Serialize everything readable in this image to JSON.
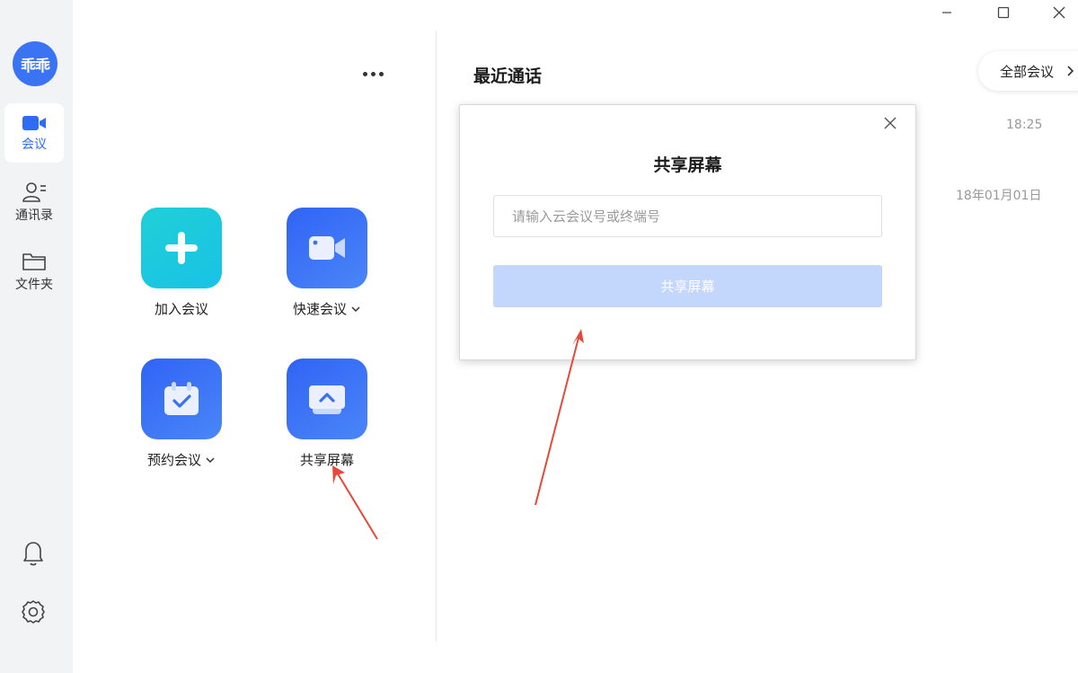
{
  "sidebar": {
    "avatar_text": "乖乖",
    "items": [
      {
        "label": "会议",
        "icon": "video-camera-icon",
        "active": true
      },
      {
        "label": "通讯录",
        "icon": "contacts-icon",
        "active": false
      },
      {
        "label": "文件夹",
        "icon": "folder-icon",
        "active": false
      }
    ],
    "bottom": [
      {
        "icon": "bell-icon"
      },
      {
        "icon": "gear-icon"
      }
    ]
  },
  "actions": {
    "join": {
      "label": "加入会议",
      "icon": "plus-icon"
    },
    "quick": {
      "label": "快速会议",
      "icon": "video-camera-icon"
    },
    "schedule": {
      "label": "预约会议",
      "icon": "calendar-check-icon"
    },
    "share": {
      "label": "共享屏幕",
      "icon": "screen-share-icon"
    }
  },
  "recent": {
    "title": "最近通话",
    "all_button": "全部会议",
    "times": [
      "18:25",
      "18年01月01日"
    ]
  },
  "dialog": {
    "title": "共享屏幕",
    "input_placeholder": "请输入云会议号或终端号",
    "input_value": "",
    "button_label": "共享屏幕"
  },
  "colors": {
    "accent": "#2e6cf6",
    "tile_cyan": "#1fd0d6",
    "tile_blue": "#3b6ff5",
    "button_disabled": "#c3d6fb",
    "annotation": "#e8483a"
  }
}
